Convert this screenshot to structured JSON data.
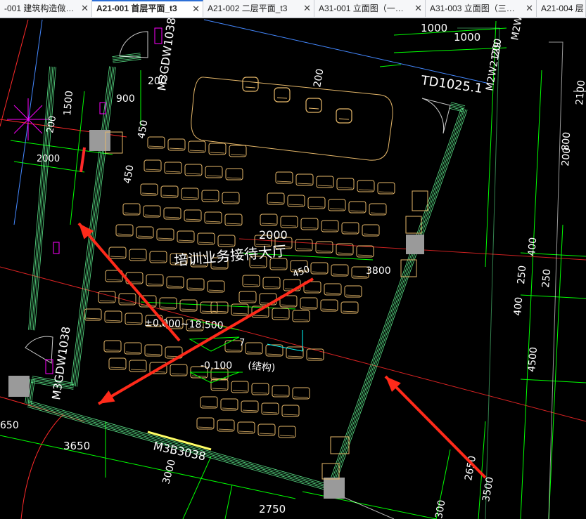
{
  "tabs": [
    {
      "label": "-001 建筑构造做…",
      "active": false
    },
    {
      "label": "A21-001 首层平面_t3",
      "active": true
    },
    {
      "label": "A21-002 二层平面_t3",
      "active": false
    },
    {
      "label": "A31-001 立面图（一…",
      "active": false
    },
    {
      "label": "A31-003 立面图（三…",
      "active": false
    },
    {
      "label": "A21-004 层",
      "active": false
    }
  ],
  "close_glyph": "✕",
  "drawing": {
    "room_name": "培训业务接待大厅",
    "elevation_range": "±0.000~18.500",
    "elevation_low": "-0.100",
    "structure_note": "(结构)",
    "door_labels": [
      "M3GDW1038",
      "M3GDW1038",
      "M3B3038",
      "TD1025.1",
      "M2W2129",
      "M2W"
    ],
    "dimensions": [
      "1000",
      "1000",
      "200",
      "200",
      "900",
      "1500",
      "450",
      "450",
      "200",
      "200",
      "2000",
      "3800",
      "450",
      "2000",
      "3650",
      "3000",
      "2750",
      "650",
      "2650",
      "3500",
      "4500",
      "400",
      "250",
      "250",
      "400",
      "2100",
      "800",
      "200",
      "300"
    ]
  },
  "colors": {
    "background": "#000000",
    "wall": "#66ff99",
    "dim_line": "#00ff00",
    "furniture": "#e6b86a",
    "axis_red": "#ff2a2a",
    "text": "#ffffff",
    "arrow": "#ff2a1a",
    "door_swing": "#ffffff",
    "column": "#9a9a9a",
    "magenta": "#ff00ff"
  }
}
